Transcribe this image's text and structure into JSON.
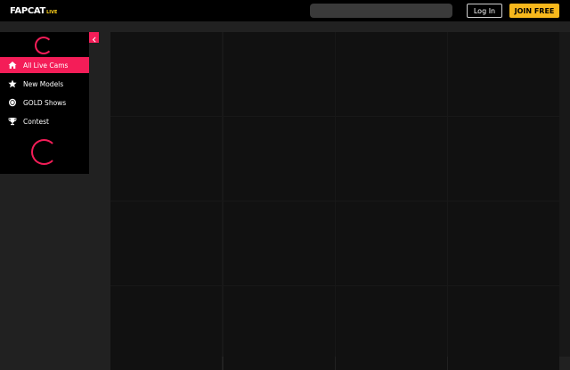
{
  "header": {
    "logo_main": "FAPCAT",
    "logo_live": "LIVE",
    "search_placeholder": "",
    "login_label": "Log In",
    "join_label": "JOIN FREE"
  },
  "sidebar": {
    "collapse_icon": "chevron-left-icon",
    "items": [
      {
        "label": "All Live Cams",
        "icon": "home-icon",
        "active": true
      },
      {
        "label": "New Models",
        "icon": "star-icon",
        "active": false
      },
      {
        "label": "GOLD Shows",
        "icon": "coin-icon",
        "active": false
      },
      {
        "label": "Contest",
        "icon": "trophy-icon",
        "active": false
      }
    ]
  },
  "colors": {
    "accent": "#f41d58",
    "gold": "#f7b81c",
    "background": "#212121",
    "topbar": "#000000"
  }
}
